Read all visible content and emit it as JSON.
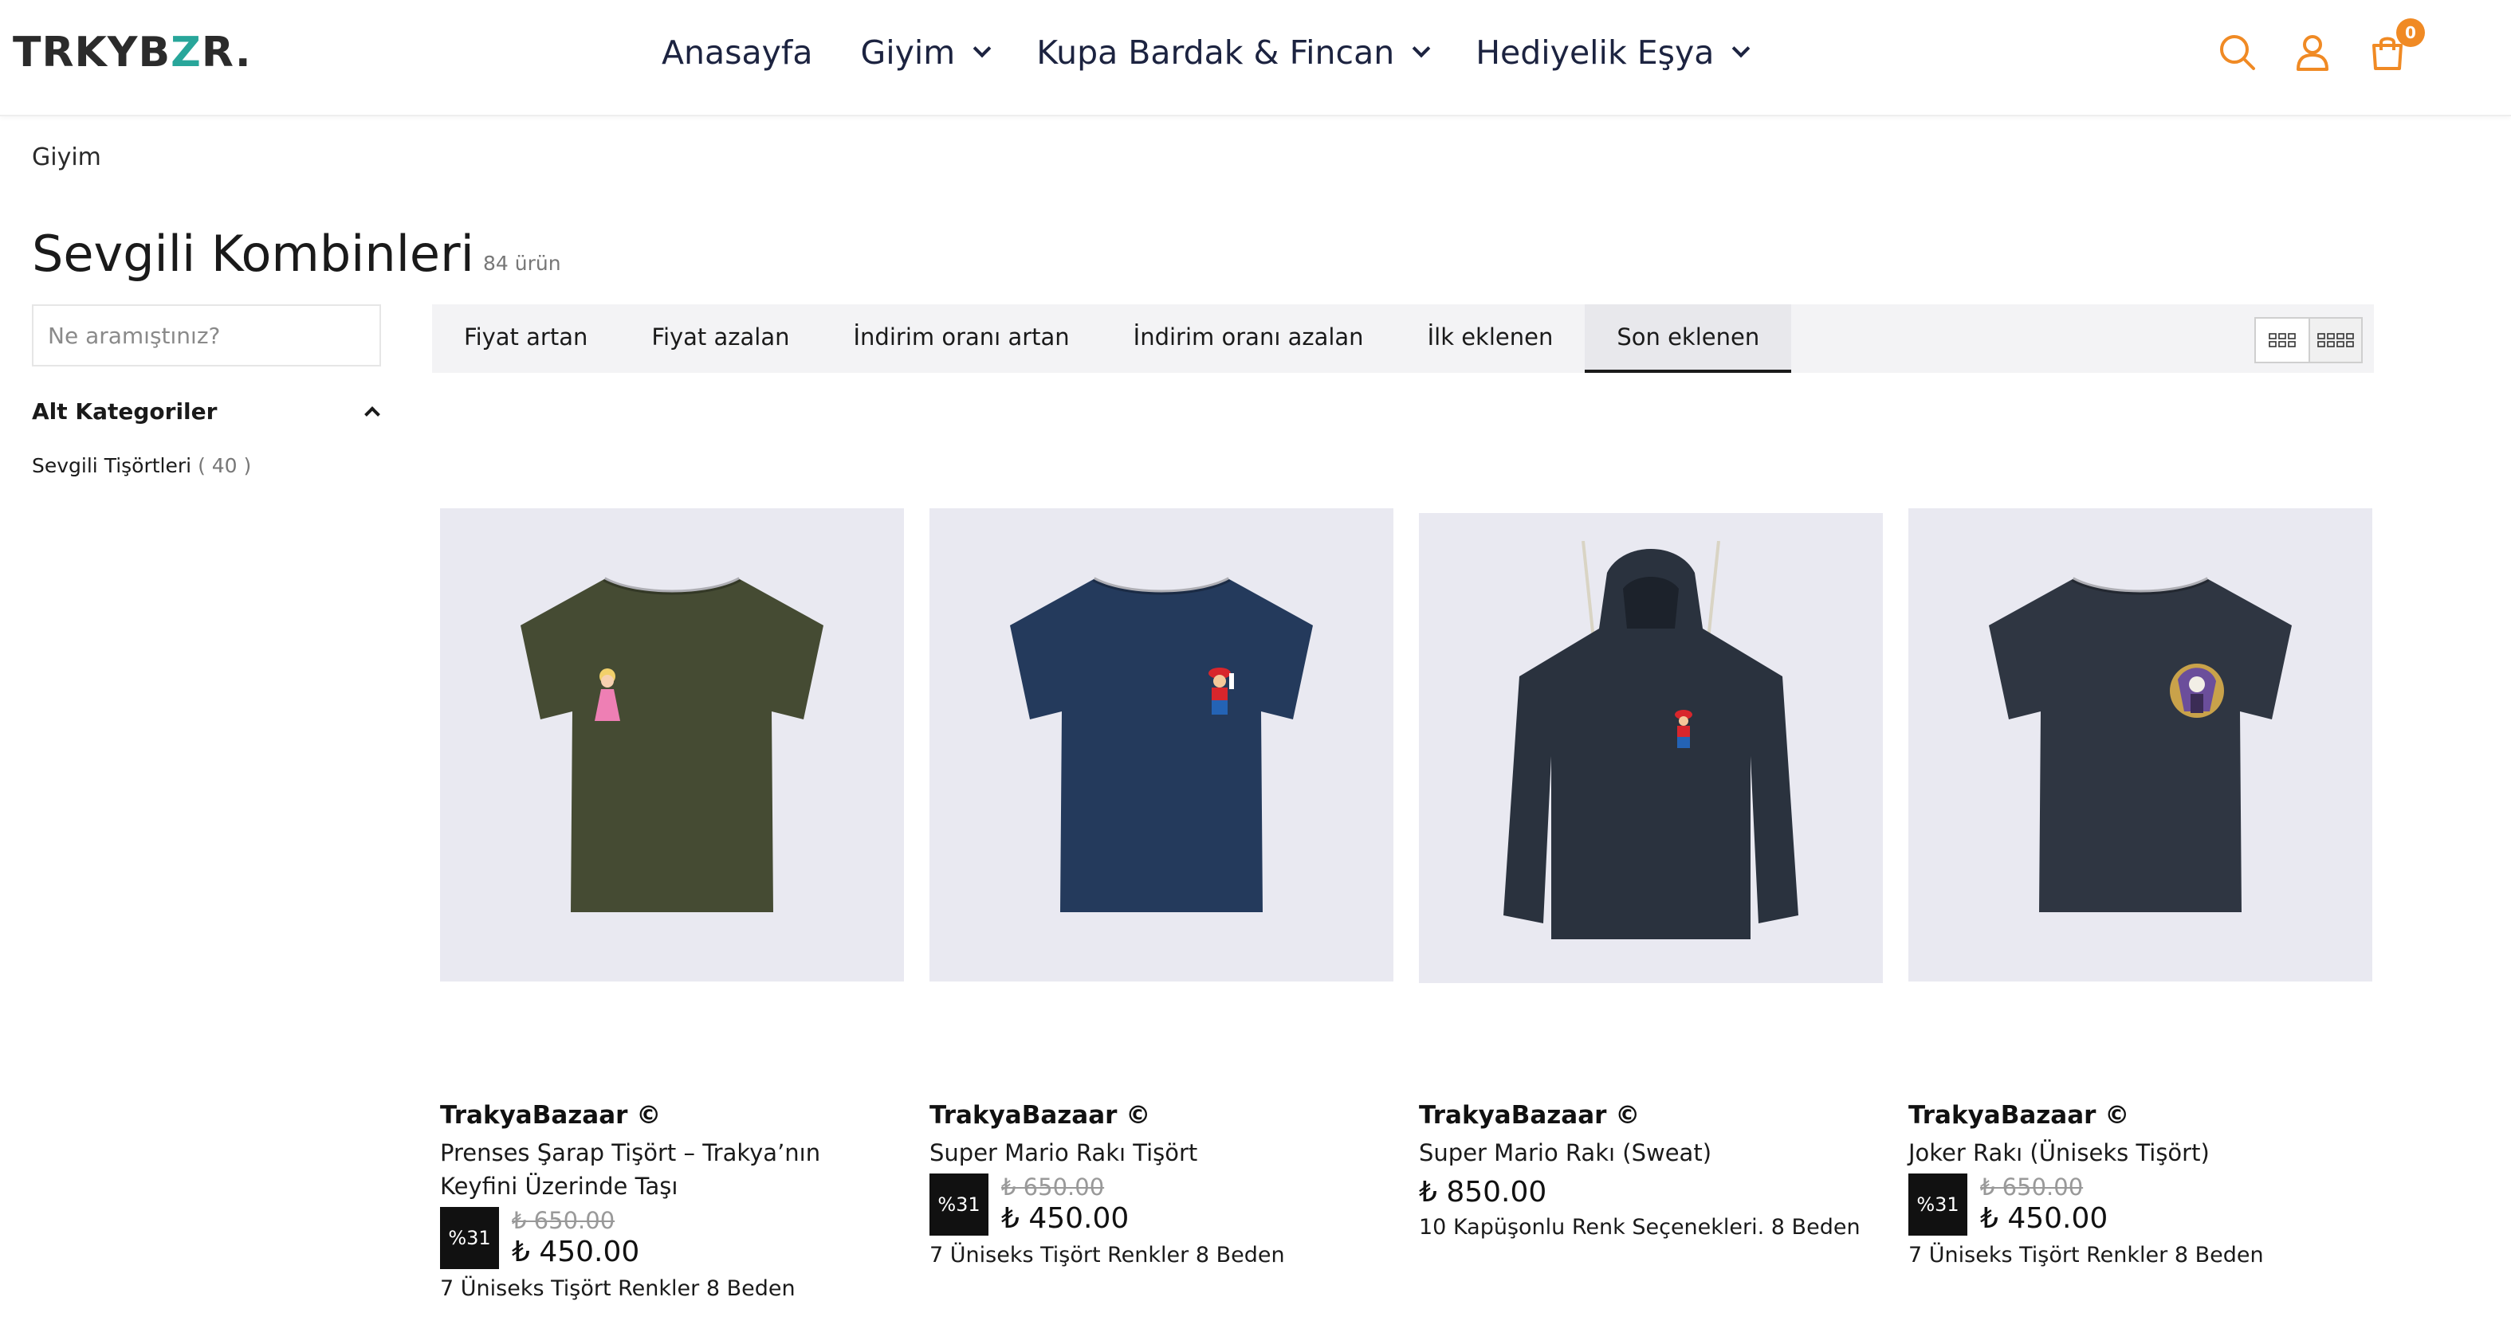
{
  "header": {
    "logo": "TRKYBZR.",
    "nav": [
      {
        "label": "Anasayfa",
        "dropdown": false
      },
      {
        "label": "Giyim",
        "dropdown": true
      },
      {
        "label": "Kupa Bardak & Fincan",
        "dropdown": true
      },
      {
        "label": "Hediyelik Eşya",
        "dropdown": true
      }
    ],
    "icons": [
      "search-icon",
      "user-icon",
      "cart-icon"
    ],
    "cart_count": "0",
    "accent_color": "#f08a24"
  },
  "breadcrumb": "Giyim",
  "page": {
    "title": "Sevgili Kombinleri",
    "count": "84 ürün"
  },
  "sidebar": {
    "search_placeholder": "Ne aramıştınız?",
    "subcategories_title": "Alt Kategoriler",
    "subcategories": [
      {
        "label": "Sevgili Tişörtleri",
        "count": "( 40 )"
      }
    ]
  },
  "sort": {
    "tabs": [
      "Fiyat artan",
      "Fiyat azalan",
      "İndirim oranı artan",
      "İndirim oranı azalan",
      "İlk eklenen",
      "Son eklenen"
    ],
    "active": "Son eklenen"
  },
  "products": [
    {
      "brand": "TrakyaBazaar ©",
      "name": "Prenses Şarap Tişört – Trakya’nın Keyfini Üzerinde Taşı",
      "discount": "%31",
      "old_price": "₺ 650.00",
      "price": "₺ 450.00",
      "note": "7 Üniseks Tişört Renkler 8 Beden",
      "color": "#454b33"
    },
    {
      "brand": "TrakyaBazaar ©",
      "name": "Super Mario Rakı Tişört",
      "discount": "%31",
      "old_price": "₺ 650.00",
      "price": "₺ 450.00",
      "note": "7 Üniseks Tişört Renkler 8 Beden",
      "color": "#243a5c"
    },
    {
      "brand": "TrakyaBazaar ©",
      "name": "Super Mario Rakı (Sweat)",
      "discount": "",
      "old_price": "",
      "price": "₺ 850.00",
      "note": "10 Kapüşonlu Renk Seçenekleri. 8 Beden",
      "color": "#2a323e"
    },
    {
      "brand": "TrakyaBazaar ©",
      "name": "Joker Rakı (Üniseks Tişört)",
      "discount": "%31",
      "old_price": "₺ 650.00",
      "price": "₺ 450.00",
      "note": "7 Üniseks Tişört Renkler 8 Beden",
      "color": "#2f3642"
    }
  ]
}
